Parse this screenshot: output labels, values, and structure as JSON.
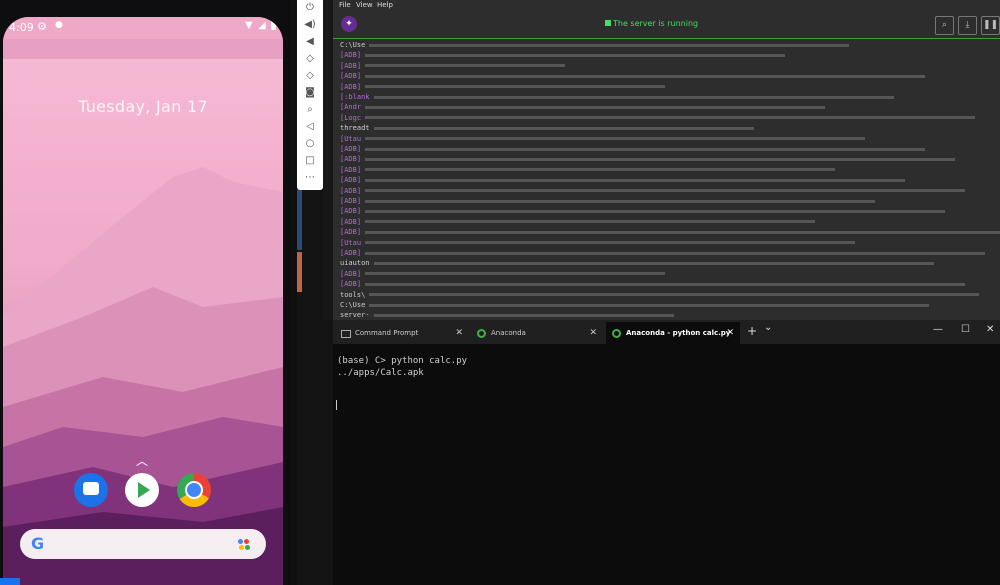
{
  "phone": {
    "status_time": "4:09",
    "date": "Tuesday, Jan 17",
    "search_g": "G"
  },
  "emulator_toolbar": {
    "buttons": [
      "power-icon",
      "volume-up-icon",
      "volume-down-icon",
      "rotate-left-icon",
      "rotate-right-icon",
      "camera-icon",
      "zoom-icon",
      "back-icon",
      "home-icon",
      "overview-icon",
      "more-icon"
    ]
  },
  "appium": {
    "menu": [
      "File",
      "View",
      "Help"
    ],
    "status": "The server is running",
    "log_prefixes": [
      "C:\\Use",
      "[ADB]",
      "[ADB]",
      "[ADB]",
      "[ADB]",
      "[:blank",
      "[Andr",
      "[Logc",
      "threadt",
      "[Utau",
      "[ADB]",
      "[ADB]",
      "[ADB]",
      "[ADB]",
      "[ADB]",
      "[ADB]",
      "[ADB]",
      "[ADB]",
      "[ADB]",
      "[Utau",
      "[ADB]",
      "uiauton",
      "[ADB]",
      "[ADB]",
      "tools\\",
      "C:\\Use",
      "server-"
    ]
  },
  "terminal": {
    "tabs": [
      {
        "label": "Command Prompt"
      },
      {
        "label": "Anaconda"
      },
      {
        "label": "Anaconda - python  calc.py"
      }
    ],
    "new_tab": "+",
    "dropdown": "⌄",
    "lines": [
      "(base) C> python calc.py",
      "../apps/Calc.apk"
    ],
    "window_controls": {
      "minimize": "—",
      "maximize": "☐",
      "close": "✕"
    }
  }
}
